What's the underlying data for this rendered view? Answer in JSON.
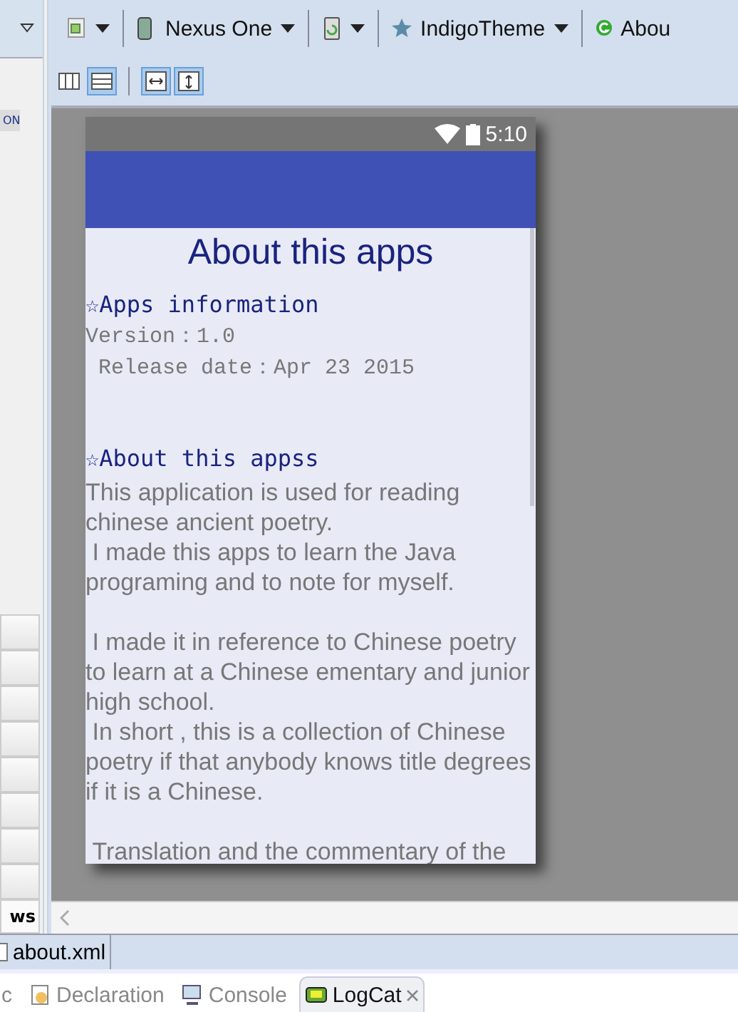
{
  "left_panel": {
    "chip": "ON",
    "footer": "ws"
  },
  "toolbar": {
    "items": [
      {
        "kind": "file"
      },
      {
        "kind": "device",
        "label": "Nexus One"
      },
      {
        "kind": "rotate"
      },
      {
        "kind": "theme",
        "label": "IndigoTheme"
      },
      {
        "kind": "activity",
        "label": "Abou"
      }
    ],
    "toggles": [
      {
        "kind": "columns",
        "selected": false
      },
      {
        "kind": "rows",
        "selected": true
      },
      {
        "kind": "fit-width",
        "selected": true
      },
      {
        "kind": "fit-height",
        "selected": true
      }
    ]
  },
  "phone": {
    "status_bar": {
      "time": "5:10"
    },
    "title": "About this apps",
    "sections": [
      {
        "heading": "☆Apps information",
        "lines": [
          "Version：1.0",
          " Release date：Apr 23 2015"
        ]
      },
      {
        "heading": "☆About this appss",
        "paragraphs": [
          "This application is used for reading chinese ancient poetry.\n I made this apps to learn the Java programing and to note for myself.\n\n I made it in reference to Chinese poetry to learn at a Chinese ementary and junior high school.\n In short , this is a collection of Chinese poetry if that anybody knows title degrees if it is a Chinese.",
          " Translation and the commentary of the"
        ]
      }
    ]
  },
  "editor_tabs": [
    {
      "label": "about.xml"
    }
  ],
  "bottom_tabs": [
    {
      "label": "c",
      "selected": false,
      "kind": "doc"
    },
    {
      "label": "Declaration",
      "selected": false,
      "kind": "declaration"
    },
    {
      "label": "Console",
      "selected": false,
      "kind": "console"
    },
    {
      "label": "LogCat",
      "selected": true,
      "kind": "logcat"
    }
  ]
}
